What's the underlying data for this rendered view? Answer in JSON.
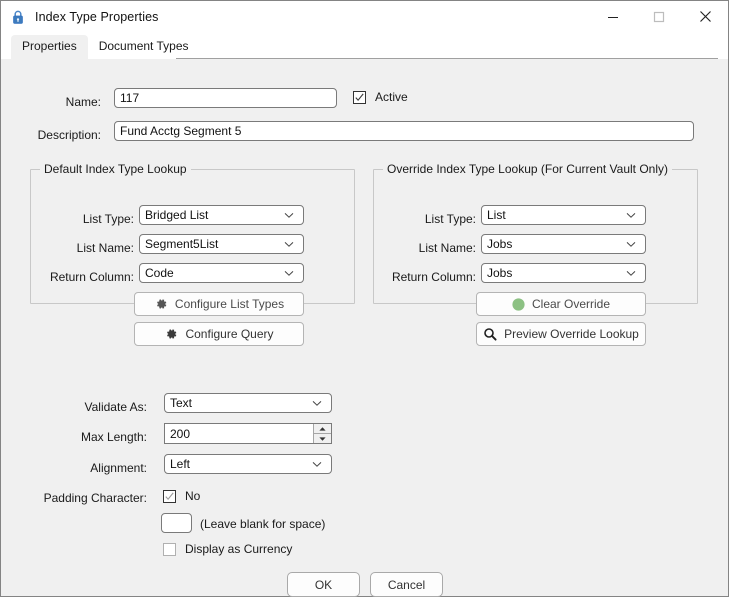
{
  "window": {
    "title": "Index Type Properties",
    "icon": "lock-icon",
    "controls": {
      "minimize": "minimize-icon",
      "maximize": "maximize-icon",
      "close": "close-icon"
    }
  },
  "tabs": [
    {
      "label": "Properties",
      "selected": true
    },
    {
      "label": "Document Types",
      "selected": false
    }
  ],
  "form": {
    "name_label": "Name:",
    "name_value": "117",
    "active_label": "Active",
    "active_checked": true,
    "description_label": "Description:",
    "description_value": "Fund Acctg Segment 5"
  },
  "default_lookup": {
    "title": "Default Index Type Lookup",
    "list_type_label": "List Type:",
    "list_type_value": "Bridged List",
    "list_name_label": "List Name:",
    "list_name_value": "Segment5List",
    "return_column_label": "Return Column:",
    "return_column_value": "Code",
    "configure_list_types_label": "Configure List Types",
    "configure_query_label": "Configure Query"
  },
  "override_lookup": {
    "title": "Override Index Type Lookup (For Current Vault Only)",
    "list_type_label": "List Type:",
    "list_type_value": "List",
    "list_name_label": "List Name:",
    "list_name_value": "Jobs",
    "return_column_label": "Return Column:",
    "return_column_value": "Jobs",
    "clear_override_label": "Clear Override",
    "preview_override_label": "Preview Override Lookup"
  },
  "validation": {
    "validate_as_label": "Validate As:",
    "validate_as_value": "Text",
    "max_length_label": "Max Length:",
    "max_length_value": "200",
    "alignment_label": "Alignment:",
    "alignment_value": "Left",
    "padding_character_label": "Padding Character:",
    "padding_no_label": "No",
    "padding_checked": true,
    "padding_char_value": "",
    "padding_hint": "(Leave blank for space)",
    "display_currency_label": "Display as Currency",
    "display_currency_checked": false
  },
  "dialog_buttons": {
    "ok_label": "OK",
    "cancel_label": "Cancel"
  },
  "colors": {
    "accent_lock": "#2f6fbe",
    "clear_override_dot": "#8cc183",
    "window_bg": "#f0f0f0",
    "titlebar_bg": "#ffffff"
  }
}
